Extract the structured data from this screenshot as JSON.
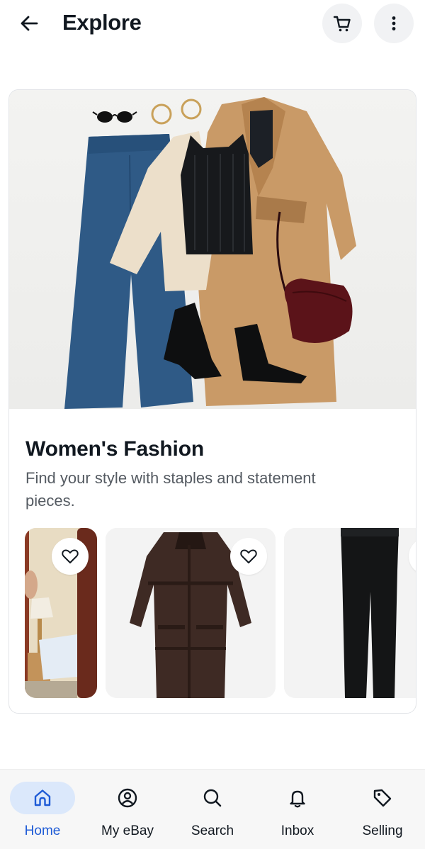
{
  "header": {
    "title": "Explore",
    "back_icon": "arrow-left-icon",
    "cart_icon": "cart-icon",
    "more_icon": "more-vertical-icon"
  },
  "card": {
    "title": "Women's Fashion",
    "subtitle": "Find your style with staples and statement pieces.",
    "hero_image": "women-fashion-flatlay-image",
    "items": [
      {
        "image": "bedroom-mirror-photo",
        "favorite_icon": "heart-outline-icon"
      },
      {
        "image": "brown-shearling-coat-photo",
        "favorite_icon": "heart-outline-icon"
      },
      {
        "image": "black-jeans-photo",
        "favorite_icon": "heart-outline-icon"
      }
    ]
  },
  "bottom_nav": {
    "items": [
      {
        "label": "Home",
        "icon": "home-icon",
        "active": true
      },
      {
        "label": "My eBay",
        "icon": "account-icon",
        "active": false
      },
      {
        "label": "Search",
        "icon": "search-icon",
        "active": false
      },
      {
        "label": "Inbox",
        "icon": "bell-icon",
        "active": false
      },
      {
        "label": "Selling",
        "icon": "tag-icon",
        "active": false
      }
    ]
  },
  "colors": {
    "accent": "#1e5bd6",
    "active_pill": "#dbe8fb",
    "text_primary": "#111820",
    "text_secondary": "#555b62"
  }
}
